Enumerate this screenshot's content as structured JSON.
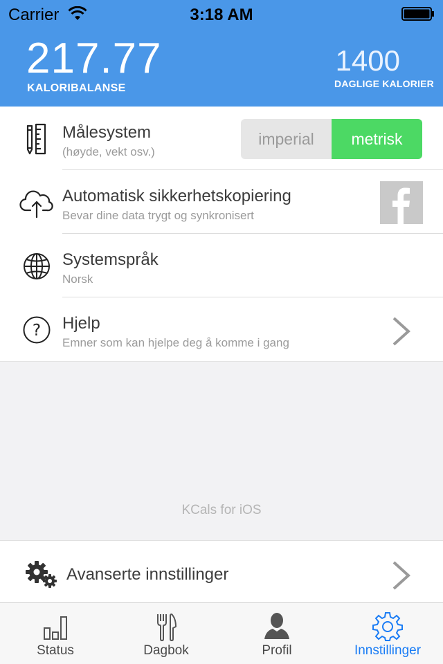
{
  "status_bar": {
    "carrier": "Carrier",
    "time": "3:18 AM"
  },
  "header": {
    "balance_value": "217.77",
    "balance_label": "KALORIBALANSE",
    "daily_value": "1400",
    "daily_label": "DAGLIGE KALORIER"
  },
  "settings": [
    {
      "title": "Målesystem",
      "subtitle": "(høyde, vekt osv.)",
      "icon": "ruler-pencil-icon"
    },
    {
      "title": "Automatisk sikkerhetskopiering",
      "subtitle": "Bevar dine data trygt og synkronisert",
      "icon": "cloud-upload-icon"
    },
    {
      "title": "Systemspråk",
      "subtitle": "Norsk",
      "icon": "globe-icon"
    },
    {
      "title": "Hjelp",
      "subtitle": "Emner som kan hjelpe deg å komme i gang",
      "icon": "question-icon"
    }
  ],
  "units_toggle": {
    "options": [
      "imperial",
      "metrisk"
    ],
    "selected": "metrisk"
  },
  "footer": {
    "text": "KCals for iOS"
  },
  "advanced": {
    "label": "Avanserte innstillinger",
    "icon": "gears-icon"
  },
  "tabs": [
    {
      "label": "Status",
      "icon": "bar-chart-icon",
      "active": false
    },
    {
      "label": "Dagbok",
      "icon": "fork-knife-icon",
      "active": false
    },
    {
      "label": "Profil",
      "icon": "person-icon",
      "active": false
    },
    {
      "label": "Innstillinger",
      "icon": "gear-icon",
      "active": true
    }
  ],
  "colors": {
    "header": "#4a97e8",
    "toggle_selected": "#4cd964",
    "tab_active": "#1a7cf5"
  }
}
